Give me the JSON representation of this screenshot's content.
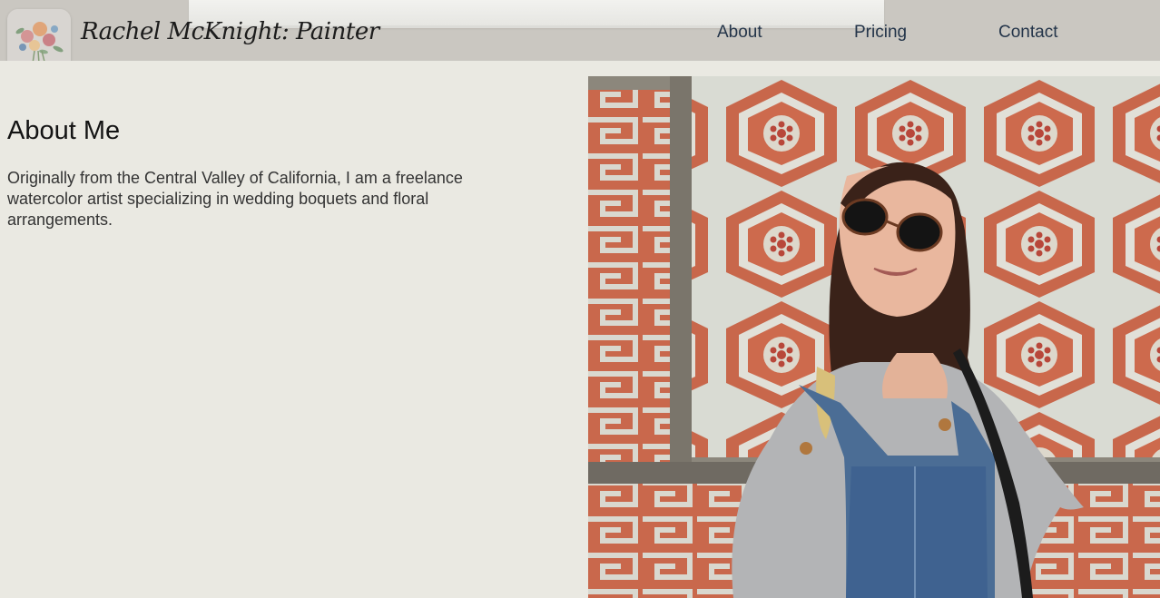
{
  "header": {
    "site_title": "Rachel McKnight: Painter",
    "logo_icon": "floral-bouquet-icon",
    "nav": [
      {
        "label": "About"
      },
      {
        "label": "Pricing"
      },
      {
        "label": "Contact"
      }
    ]
  },
  "main": {
    "heading": "About Me",
    "bio": "Originally from the Central Valley of California, I am a freelance watercolor artist specializing in wedding boquets and floral arrangements."
  },
  "photo": {
    "icon": "portrait-photo-icon"
  },
  "colors": {
    "page_background": "#eae9e2",
    "header_background": "#cac7c1",
    "nav_text": "#24354a",
    "heading_text": "#141414"
  }
}
